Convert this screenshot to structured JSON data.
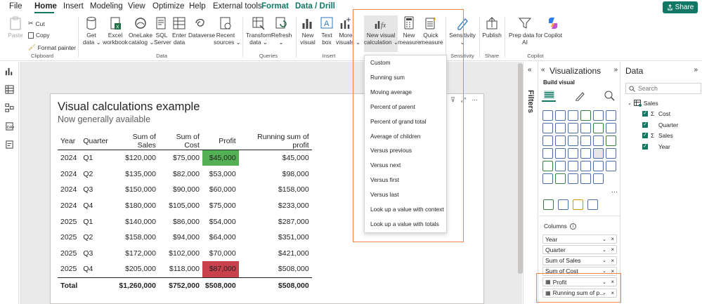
{
  "menubar": {
    "tabs": [
      "File",
      "Home",
      "Insert",
      "Modeling",
      "View",
      "Optimize",
      "Help",
      "External tools",
      "Format",
      "Data / Drill"
    ],
    "share": "Share"
  },
  "ribbon": {
    "clipboard": {
      "paste": "Paste",
      "cut": "Cut",
      "copy": "Copy",
      "format_painter": "Format painter",
      "group": "Clipboard"
    },
    "data": {
      "get_data": "Get\ndata ⌄",
      "excel": "Excel\nworkbook",
      "onelake": "OneLake\ncatalog ⌄",
      "sql": "SQL\nServer",
      "enter": "Enter\ndata",
      "dataverse": "Dataverse",
      "recent": "Recent\nsources ⌄",
      "group": "Data"
    },
    "queries": {
      "transform": "Transform\ndata ⌄",
      "refresh": "Refresh\n⌄",
      "group": "Queries"
    },
    "insert": {
      "new_visual": "New\nvisual",
      "text_box": "Text\nbox",
      "more_visuals": "More\nvisuals ⌄",
      "group": "Insert"
    },
    "calculations": {
      "new_visual_calc": "New visual\ncalculation ⌄",
      "new_measure": "New\nmeasure",
      "quick_measure": "Quick\nmeasure"
    },
    "sensitivity": {
      "label": "Sensitivity\n⌄",
      "group": "Sensitivity"
    },
    "share": {
      "publish": "Publish",
      "group": "Share"
    },
    "copilot": {
      "prep": "Prep data for\nAI",
      "copilot": "Copilot",
      "group": "Copilot"
    }
  },
  "dropdown_menu": {
    "items": [
      "Custom",
      "Running sum",
      "Moving average",
      "Percent of parent",
      "Percent of grand total",
      "Average of children",
      "Versus previous",
      "Versus next",
      "Versus first",
      "Versus last",
      "Look up a value with context",
      "Look up a value with totals"
    ]
  },
  "visual": {
    "title": "Visual calculations example",
    "subtitle": "Now generally available",
    "columns": [
      "Year",
      "Quarter",
      "Sum of Sales",
      "Sum of Cost",
      "Profit",
      "Running sum of profit"
    ],
    "rows": [
      [
        "2024",
        "Q1",
        "$120,000",
        "$75,000",
        "$45,000",
        "$45,000"
      ],
      [
        "2024",
        "Q2",
        "$135,000",
        "$82,000",
        "$53,000",
        "$98,000"
      ],
      [
        "2024",
        "Q3",
        "$150,000",
        "$90,000",
        "$60,000",
        "$158,000"
      ],
      [
        "2024",
        "Q4",
        "$180,000",
        "$105,000",
        "$75,000",
        "$233,000"
      ],
      [
        "2025",
        "Q1",
        "$140,000",
        "$86,000",
        "$54,000",
        "$287,000"
      ],
      [
        "2025",
        "Q2",
        "$158,000",
        "$94,000",
        "$64,000",
        "$351,000"
      ],
      [
        "2025",
        "Q3",
        "$172,000",
        "$102,000",
        "$70,000",
        "$421,000"
      ],
      [
        "2025",
        "Q4",
        "$205,000",
        "$118,000",
        "$87,000",
        "$508,000"
      ]
    ],
    "total": [
      "Total",
      "",
      "$1,260,000",
      "$752,000",
      "$508,000",
      "$508,000"
    ],
    "highlight_colors": {
      "max_profit": "#54b054",
      "min_profit_alt": "#c8414b"
    }
  },
  "filters_pane": {
    "label": "Filters"
  },
  "visualizations_pane": {
    "title": "Visualizations",
    "build_visual": "Build visual",
    "more": "···",
    "columns_label": "Columns",
    "wells": [
      "Year",
      "Quarter",
      "Sum of Sales",
      "Sum of Cost",
      "Profit",
      "Running sum of p..."
    ]
  },
  "data_pane": {
    "title": "Data",
    "search_placeholder": "Search",
    "table": "Sales",
    "fields": [
      {
        "name": "Cost",
        "sigma": true,
        "checked": true
      },
      {
        "name": "Quarter",
        "sigma": false,
        "checked": true
      },
      {
        "name": "Sales",
        "sigma": true,
        "checked": true
      },
      {
        "name": "Year",
        "sigma": false,
        "checked": true
      }
    ]
  },
  "colors": {
    "accent": "#117865",
    "highlight_box": "#f0844a",
    "checkbox": "#117865"
  }
}
